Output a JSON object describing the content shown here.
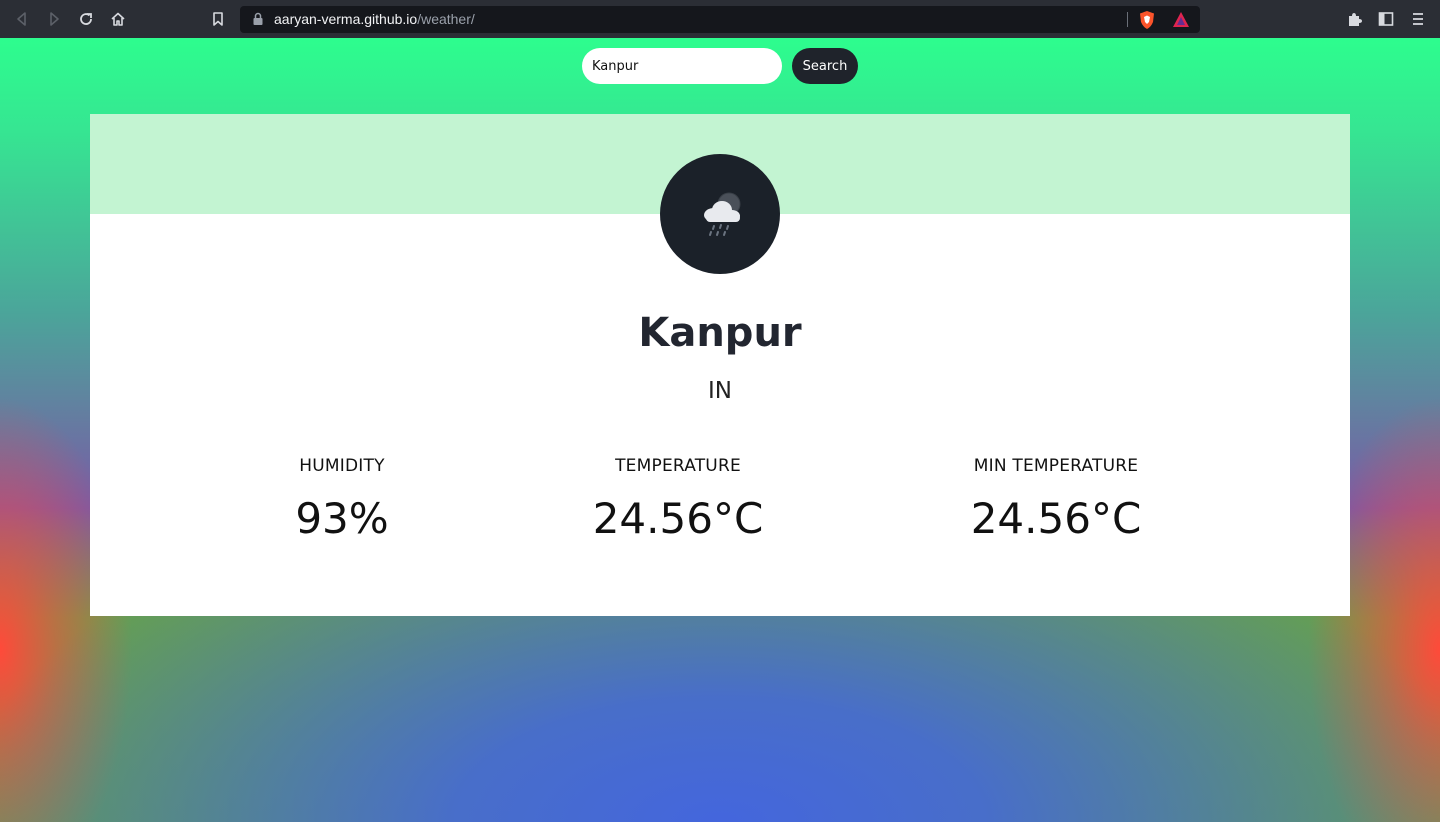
{
  "browser": {
    "url_host": "aaryan-verma.github.io",
    "url_path": "/weather/",
    "icons": [
      "back-icon",
      "forward-icon",
      "reload-icon",
      "home-icon",
      "bookmark-icon",
      "lock-icon",
      "brave-shield-icon",
      "brave-rewards-icon",
      "extensions-icon",
      "sidebar-icon",
      "menu-icon"
    ]
  },
  "search": {
    "value": "Kanpur",
    "button_label": "Search"
  },
  "weather": {
    "icon": "rain-cloud-night-icon",
    "city": "Kanpur",
    "country": "IN",
    "stats": [
      {
        "label": "HUMIDITY",
        "value": "93%"
      },
      {
        "label": "TEMPERATURE",
        "value": "24.56°C"
      },
      {
        "label": "MIN TEMPERATURE",
        "value": "24.56°C"
      }
    ]
  },
  "colors": {
    "card_header": "#c3f4d2",
    "icon_circle": "#1b2129",
    "button": "#1f232b"
  }
}
